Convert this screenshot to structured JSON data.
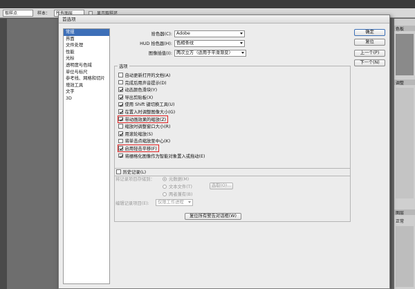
{
  "background": {
    "options_bar": {
      "dropdown_value": "取样点",
      "sample_label": "样本：",
      "sample_value": "所有图层",
      "check_label": "显示取样环"
    },
    "right_panel": {
      "label_top": "色板",
      "label_mid": "调整",
      "label_bottom1": "图层",
      "label_bottom2": "正常"
    }
  },
  "dialog": {
    "title": "首选项",
    "nav_items": [
      {
        "label": "常规",
        "active": true
      },
      {
        "label": "界面",
        "active": false
      },
      {
        "label": "文件处理",
        "active": false
      },
      {
        "label": "性能",
        "active": false
      },
      {
        "label": "光标",
        "active": false
      },
      {
        "label": "透明度与色域",
        "active": false
      },
      {
        "label": "单位与标尺",
        "active": false
      },
      {
        "label": "参考线、网格和切片",
        "active": false
      },
      {
        "label": "增效工具",
        "active": false
      },
      {
        "label": "文字",
        "active": false
      },
      {
        "label": "3D",
        "active": false
      }
    ],
    "fields": [
      {
        "label": "拾色器(C):",
        "value": "Adobe"
      },
      {
        "label": "HUD 拾色器(H):",
        "value": "色相条纹"
      },
      {
        "label": "图像插值(I):",
        "value": "两次立方（适用于平滑渐变）"
      }
    ],
    "options_title": "选项",
    "options": [
      {
        "label": "自动更新打开的文档(A)",
        "checked": false,
        "highlight": false
      },
      {
        "label": "完成后用声音提示(D)",
        "checked": false,
        "highlight": false
      },
      {
        "label": "动态颜色滑块(Y)",
        "checked": true,
        "highlight": false
      },
      {
        "label": "导出剪贴板(X)",
        "checked": true,
        "highlight": false
      },
      {
        "label": "使用 Shift 键切换工具(U)",
        "checked": true,
        "highlight": false
      },
      {
        "label": "在置入时调整图像大小(G)",
        "checked": true,
        "highlight": false
      },
      {
        "label": "带动画效果的缩放(Z)",
        "checked": true,
        "highlight": true
      },
      {
        "label": "缩放时调整窗口大小(R)",
        "checked": false,
        "highlight": false
      },
      {
        "label": "用滚轮缩放(S)",
        "checked": true,
        "highlight": false
      },
      {
        "label": "将单击点缩放至中心(K)",
        "checked": false,
        "highlight": false
      },
      {
        "label": "启用轻击平移(F)",
        "checked": true,
        "highlight": true
      },
      {
        "label": "将栅格化图像作为智能对象置入或拖动(E)",
        "checked": true,
        "highlight": false
      }
    ],
    "history": {
      "title": "历史记录(L)",
      "save_label": "将记录项目存储到：",
      "radio1": "元数据(M)",
      "radio2": "文本文件(T)",
      "choose_button": "选取(O)...",
      "radio3": "两者兼有(B)",
      "edit_label": "编辑记录项目(E):",
      "edit_value": "仅限工作进程"
    },
    "reset_warnings_button": "复位所有警告对话框(W)",
    "buttons": {
      "ok": "确定",
      "reset": "复位",
      "prev": "上一个(P)",
      "next": "下一个(N)"
    }
  }
}
